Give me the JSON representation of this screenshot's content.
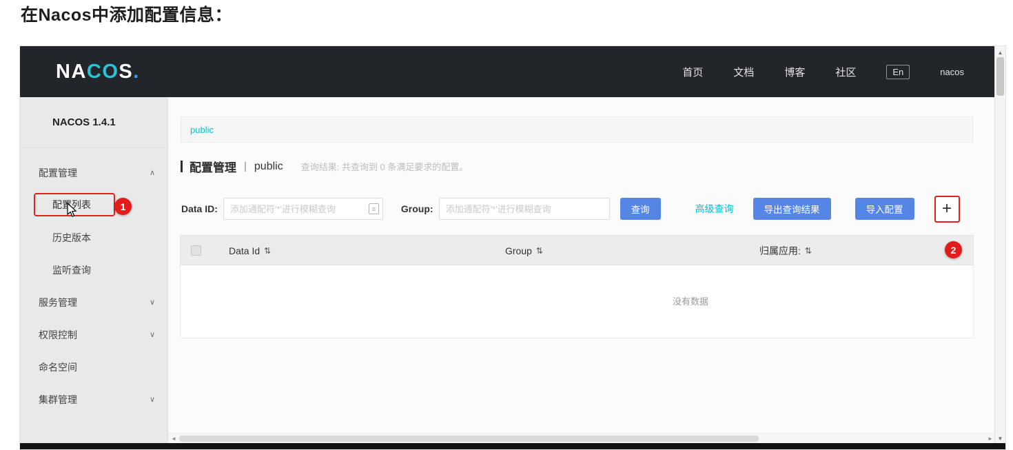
{
  "page": {
    "heading": "在Nacos中添加配置信息："
  },
  "header": {
    "logo": {
      "na": "NA",
      "co": "CO",
      "s": "S",
      "dot": "."
    },
    "nav": [
      {
        "label": "首页"
      },
      {
        "label": "文档"
      },
      {
        "label": "博客"
      },
      {
        "label": "社区"
      },
      {
        "label": "En"
      },
      {
        "label": "nacos"
      }
    ]
  },
  "sidebar": {
    "version": "NACOS 1.4.1",
    "items": [
      {
        "label": "配置管理",
        "caret": "∧"
      },
      {
        "label": "配置列表",
        "caret": ""
      },
      {
        "label": "历史版本",
        "caret": ""
      },
      {
        "label": "监听查询",
        "caret": ""
      },
      {
        "label": "服务管理",
        "caret": "∨"
      },
      {
        "label": "权限控制",
        "caret": "∨"
      },
      {
        "label": "命名空间",
        "caret": ""
      },
      {
        "label": "集群管理",
        "caret": "∨"
      }
    ]
  },
  "main": {
    "namespace_tab": "public",
    "title": "配置管理",
    "title_separator": "|",
    "title_namespace": "public",
    "result_text": "查询结果: 共查询到 0 条满足要求的配置。",
    "form": {
      "dataid_label": "Data ID:",
      "dataid_value": "",
      "dataid_placeholder": "添加通配符'*'进行模糊查询",
      "group_label": "Group:",
      "group_value": "",
      "group_placeholder": "添加通配符'*'进行模糊查询",
      "search_button": "查询",
      "advanced_query_link": "高级查询",
      "export_button": "导出查询结果",
      "import_button": "导入配置",
      "add_button": "+",
      "fuzzy_icon": "≣"
    },
    "table": {
      "columns": [
        {
          "label": "Data Id",
          "sort_icon": "⇅"
        },
        {
          "label": "Group",
          "sort_icon": "⇅"
        },
        {
          "label": "归属应用:",
          "sort_icon": "⇅"
        }
      ],
      "empty_text": "没有数据"
    }
  },
  "annotations": {
    "step1": "1",
    "step2": "2"
  },
  "scrollbar": {
    "up": "▲",
    "down": "▼",
    "left": "◄",
    "right": "►"
  }
}
